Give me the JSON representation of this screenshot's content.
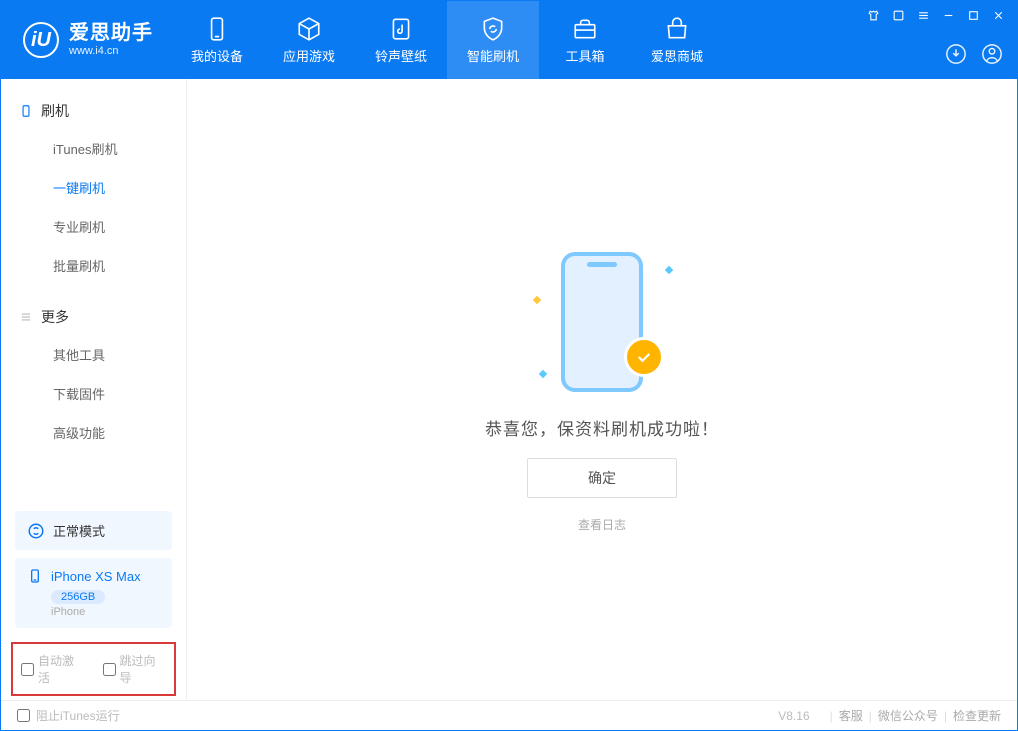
{
  "app": {
    "logo_letter": "iU",
    "name": "爱思助手",
    "domain": "www.i4.cn"
  },
  "nav": {
    "tabs": [
      {
        "label": "我的设备"
      },
      {
        "label": "应用游戏"
      },
      {
        "label": "铃声壁纸"
      },
      {
        "label": "智能刷机"
      },
      {
        "label": "工具箱"
      },
      {
        "label": "爱思商城"
      }
    ]
  },
  "sidebar": {
    "section1": {
      "title": "刷机",
      "items": [
        {
          "label": "iTunes刷机"
        },
        {
          "label": "一键刷机"
        },
        {
          "label": "专业刷机"
        },
        {
          "label": "批量刷机"
        }
      ]
    },
    "section2": {
      "title": "更多",
      "items": [
        {
          "label": "其他工具"
        },
        {
          "label": "下载固件"
        },
        {
          "label": "高级功能"
        }
      ]
    },
    "mode": "正常模式",
    "device": {
      "name": "iPhone XS Max",
      "capacity": "256GB",
      "type": "iPhone"
    },
    "checkboxes": {
      "auto_activate": "自动激活",
      "skip_guide": "跳过向导"
    }
  },
  "main": {
    "success_message": "恭喜您，保资料刷机成功啦！",
    "confirm_button": "确定",
    "view_log": "查看日志"
  },
  "footer": {
    "block_itunes": "阻止iTunes运行",
    "version": "V8.16",
    "links": {
      "support": "客服",
      "wechat": "微信公众号",
      "check_update": "检查更新"
    }
  }
}
